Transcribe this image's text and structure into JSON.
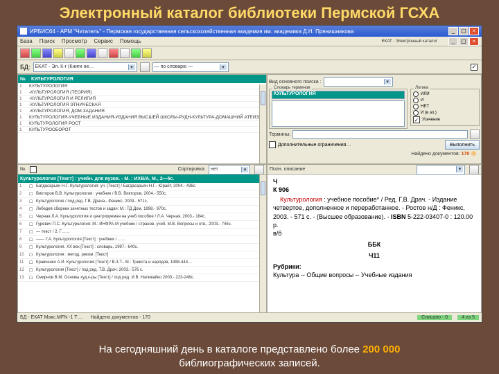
{
  "title": "Электронный каталог библиотеки Пермской ГСХА",
  "window": {
    "title": "ИРБИС64 - АРМ \"Читатель\" - Пермская государственная сельскохозяйственная академия им. академика Д.Н. Прянишникова",
    "tab": "EKAT - Электронный каталог"
  },
  "menu": [
    "База",
    "Поиск",
    "Просмотр",
    "Сервис",
    "Помощь"
  ],
  "filter": {
    "db_label": "БД:",
    "db_value": "EKAT - Эл. К-г (Книги не…",
    "dict_value": "— по словарю —"
  },
  "left_top": {
    "col1": "№",
    "col2": "КУЛЬТУРОЛОГИЯ",
    "rows": [
      {
        "n": "1",
        "t": "КУЛЬТУРОЛОГИЯ"
      },
      {
        "n": "1",
        "t": "-КУЛЬТУРОЛОГИЯ (ТЕОРИЯ)"
      },
      {
        "n": "1",
        "t": "-КУЛЬТУРОЛОГИЯ И РЕЛИГИЯ"
      },
      {
        "n": "1",
        "t": "-КУЛЬТУРОЛОГИЯ ЭТНИЧЕСКАЯ"
      },
      {
        "n": "1",
        "t": "-КУЛЬТУРОЛОГИЯ, ДОМ.ЗАДАНИЯ"
      },
      {
        "n": "1",
        "t": "КУЛЬТУРОЛОГИЯ-УЧЕБНЫЕ ИЗДАНИЯ-ИЗДАНИЯ ВЫСШЕЙ ШКОЛЫ-РУДН-КУЛЬТУРА-ДОМАШНИЙ АТЕИЗМ"
      },
      {
        "n": "1",
        "t": "КУЛЬТУРОЛОГИЯ РОСТ"
      },
      {
        "n": "1",
        "t": "КУЛЬТУРООБОРОТ"
      }
    ]
  },
  "right_top": {
    "label_view": "Вид основного поиска :",
    "label_dict": "Словарь терминов",
    "term": "КУЛЬТУРОЛОГИЯ",
    "logic_label": "Логика",
    "logic_opts": [
      "ИЛИ",
      "И",
      "НЕТ",
      "И (в эл.)"
    ],
    "trunc_label": "Усечение",
    "term_label": "Термины:",
    "full_label": "Дополнительные ограничения…",
    "search_btn": "Выполнить",
    "found_label": "Найдено документов:",
    "found_count": "170"
  },
  "bottom_left": {
    "hdr": "№",
    "sort_label": "Сортировка",
    "sort_value": "нет",
    "title_bar": "Культурология [Текст] : учебн. для вузов. - М. : ИХВ/А, М., 2—5с.",
    "rows": [
      "Багдасарьян Н.Г. Культурология: уч. [Текст] / Багдасарьян Н.Г.- Юрайт, 2004.- 436с.",
      "Викторов В.В. Культурология : учебник / В.В. Викторов, 2004.- 550с.",
      "Культурология / под ред. Г.В. Драча.- Феникс, 2003.- 571с.",
      "Лебедев сборник зачетных тестов и задач: М.: ТД Дом, 1998.- 970с.",
      "Черная Л.А. Культурология и центрируемая на учеб.пособие / Л.А. Черная, 2003.- 184с.",
      "Гуревич П.С. Культурология: М.: ИНФРА-М учебник / странов. учеб. М.В. Вопросы и отв., 2003.- 745с.",
      "— текст / 2. Г……",
      "—— Г.А. Культурология [Текст] : учебник / ……",
      "Культурология. XX век [Текст] : словарь, 1997.- 640с.",
      "Культурология : метод. реком. [Текст]",
      "Кравченко А.И. Культурология [Текст] / В.З.Т.- М.: Трикста и народов, 1998-444…",
      "Культурология [Текст] / под ред. Т.В. Драч: 2003.- 576 с.",
      "Смирнов В.М. Основы худ.к-ры [Текст] / под ред. И.В. Наливайко 2003.- 223-246с."
    ]
  },
  "record": {
    "l1": "Ч",
    "l2": "К 906",
    "subject": "Культурология",
    "descr": " : учебное пособие* / Ред. Г.В. Драч. - Издание четвертое, дополненное и переработанное. - Ростов н/Д : Феникс, 2003. - 571 с. - (Высшее образование). - ",
    "isbn_label": "ISBN",
    "isbn": " 5-222-03407-0 : 120.00 р.",
    "loc": "в/б",
    "bbk_label": "ББК",
    "bbk": "Ч11",
    "rubr_label": "Рубрики:",
    "rubr": "Культура -- Общие вопросы -- Учебные издания"
  },
  "status": {
    "l1": "БД - ЕКАТ  Макс.MFN -1  Т…",
    "l2": "Найдено документов - 170",
    "r1": "Списано - 0",
    "r2": "4 из 5"
  },
  "footer": {
    "t1": "На сегодняшний день в каталоге представлено более ",
    "t2": "200 000",
    "t3": "библиографических записей."
  }
}
